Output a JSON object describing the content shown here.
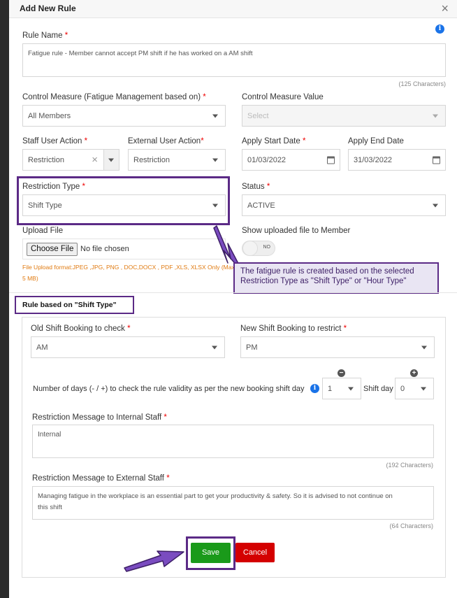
{
  "modal": {
    "title": "Add New Rule",
    "close_glyph": "×"
  },
  "icons": {
    "info": "i",
    "minus": "−",
    "plus": "+"
  },
  "rule_name": {
    "label": "Rule Name",
    "value": "Fatigue rule - Member cannot accept PM shift if he has worked on a AM shift",
    "counter": "(125 Characters)"
  },
  "control_measure": {
    "label": "Control Measure (Fatigue Management based on)",
    "value": "All Members"
  },
  "control_measure_value": {
    "label": "Control Measure Value",
    "placeholder": "Select"
  },
  "staff_user_action": {
    "label": "Staff User Action",
    "value": "Restriction",
    "clear_glyph": "×"
  },
  "external_user_action": {
    "label": "External User Action",
    "value": "Restriction"
  },
  "apply_start_date": {
    "label": "Apply Start Date",
    "value": "01/03/2022"
  },
  "apply_end_date": {
    "label": "Apply End Date",
    "value": "31/03/2022"
  },
  "restriction_type": {
    "label": "Restriction Type",
    "value": "Shift Type"
  },
  "status": {
    "label": "Status",
    "value": "ACTIVE"
  },
  "upload": {
    "label": "Upload File",
    "button": "Choose File",
    "no_file": "No file chosen",
    "hint_line1": "File Upload format:JPEG ,JPG, PNG , DOC,DOCX , PDF ,XLS, XLSX Only (Max",
    "hint_line2": "5 MB)"
  },
  "show_uploaded": {
    "label": "Show uploaded file to Member",
    "toggle_text": "NO"
  },
  "callout": {
    "line1": "The fatigue rule is created based on the selected",
    "line2": "Restriction Type as \"Shift Type\" or \"Hour Type\""
  },
  "section": {
    "title": "Rule based on \"Shift Type\""
  },
  "old_shift": {
    "label": "Old Shift Booking to check",
    "value": "AM"
  },
  "new_shift": {
    "label": "New Shift Booking to restrict",
    "value": "PM"
  },
  "days": {
    "label": "Number of days (- / +) to check the rule validity as per the new booking shift day",
    "value": "1",
    "shift_day_label": "Shift day",
    "shift_day_value": "0"
  },
  "internal_msg": {
    "label": "Restriction Message to Internal Staff",
    "value": "Internal",
    "counter": "(192 Characters)"
  },
  "external_msg": {
    "label": "Restriction Message to External Staff",
    "value_line1": "Managing fatigue in the workplace is an essential part to get your productivity & safety. So it is advised to not continue on",
    "value_line2": "this shift",
    "counter": "(64 Characters)"
  },
  "buttons": {
    "save": "Save",
    "cancel": "Cancel"
  },
  "required_mark": "*",
  "colors": {
    "accent_purple": "#5b2a86",
    "save_green": "#1a9a1a",
    "cancel_red": "#d40000",
    "info_blue": "#1a73e8",
    "hint_orange": "#e07a10"
  }
}
